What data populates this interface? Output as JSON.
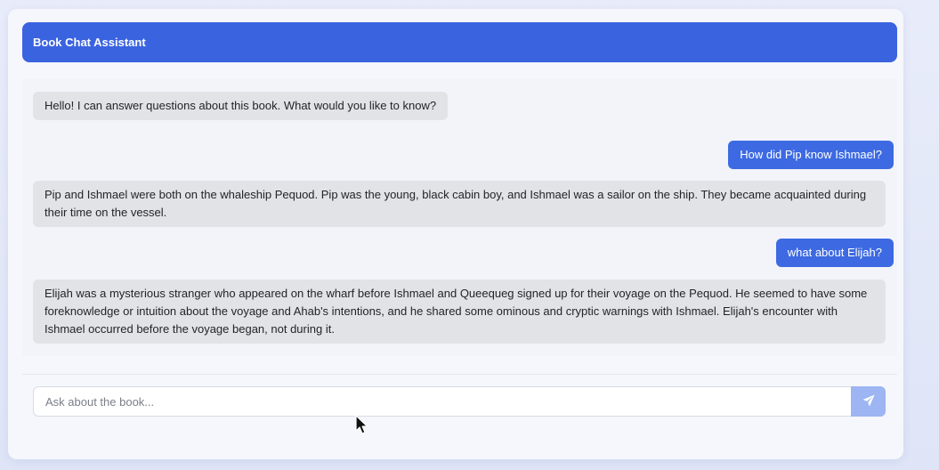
{
  "header": {
    "title": "Book Chat Assistant"
  },
  "messages": [
    {
      "role": "assistant",
      "text": "Hello! I can answer questions about this book. What would you like to know?"
    },
    {
      "role": "user",
      "text": "How did Pip know Ishmael?"
    },
    {
      "role": "assistant",
      "text": "Pip and Ishmael were both on the whaleship Pequod. Pip was the young, black cabin boy, and Ishmael was a sailor on the ship. They became acquainted during their time on the vessel."
    },
    {
      "role": "user",
      "text": "what about Elijah?"
    },
    {
      "role": "assistant",
      "text": "Elijah was a mysterious stranger who appeared on the wharf before Ishmael and Queequeg signed up for their voyage on the Pequod. He seemed to have some foreknowledge or intuition about the voyage and Ahab's intentions, and he shared some ominous and cryptic warnings with Ishmael. Elijah's encounter with Ishmael occurred before the voyage began, not during it."
    }
  ],
  "input": {
    "placeholder": "Ask about the book...",
    "value": ""
  },
  "send_button": {
    "icon": "paper-plane-icon"
  },
  "colors": {
    "header": "#3a63e0",
    "user_bubble": "#3d6ae2",
    "assistant_bubble": "#e1e3e7",
    "send_button": "#9db5f2"
  }
}
